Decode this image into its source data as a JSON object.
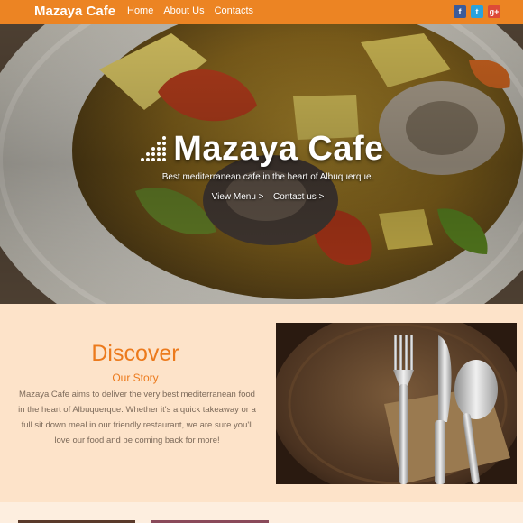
{
  "nav": {
    "brand": "Mazaya Cafe",
    "links": [
      {
        "label": "Home"
      },
      {
        "label": "About Us"
      },
      {
        "label": "Contacts"
      }
    ],
    "social": [
      {
        "icon": "facebook-icon",
        "glyph": "f"
      },
      {
        "icon": "twitter-icon",
        "glyph": "t"
      },
      {
        "icon": "google-plus-icon",
        "glyph": "g+"
      }
    ]
  },
  "hero": {
    "title": "Mazaya Cafe",
    "tagline": "Best mediterranean cafe in the heart of Albuquerque.",
    "links": [
      {
        "label": "View Menu >"
      },
      {
        "label": "Contact us >"
      }
    ]
  },
  "discover": {
    "title": "Discover",
    "subtitle": "Our Story",
    "body": "Mazaya Cafe aims to deliver the very best mediterranean food in the heart of Albuquerque. Whether it's a quick takeaway or a full sit down meal in our friendly restaurant, we are sure you'll love our food and be coming back for more!",
    "image": "cutlery-on-wooden-plate-image"
  },
  "colors": {
    "accent": "#ec8423",
    "discover_bg": "#fde3c9",
    "heading": "#ec7a1c"
  }
}
